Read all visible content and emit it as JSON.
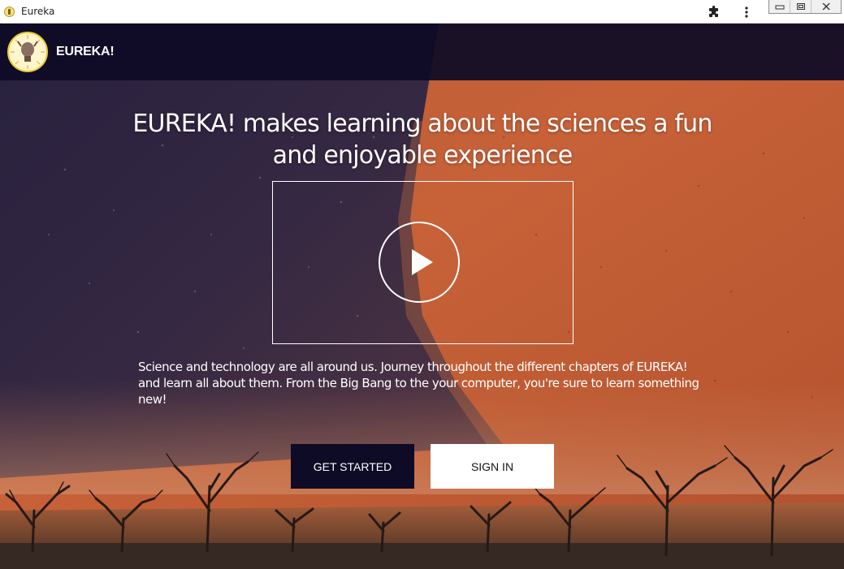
{
  "window": {
    "title": "Eureka",
    "icons": [
      "app-icon",
      "extensions-icon",
      "more-menu-icon",
      "minimize-icon",
      "restore-icon",
      "close-icon"
    ]
  },
  "navbar": {
    "brand": "EUREKA!"
  },
  "hero": {
    "headline": "EUREKA! makes learning about the sciences a fun and enjoyable experience",
    "video_icon": "play-icon",
    "description": "Science and technology are all around us. Journey throughout the different chapters of EUREKA! and learn all about them. From the Big Bang to the your computer, you're sure to learn something new!",
    "buttons": {
      "get_started": "GET STARTED",
      "sign_in": "SIGN IN"
    }
  },
  "colors": {
    "navbar": "#0e0b26",
    "primary_button": "#0d0b26",
    "dune_orange": "#d8683a",
    "dune_shadow": "#2a2240"
  }
}
